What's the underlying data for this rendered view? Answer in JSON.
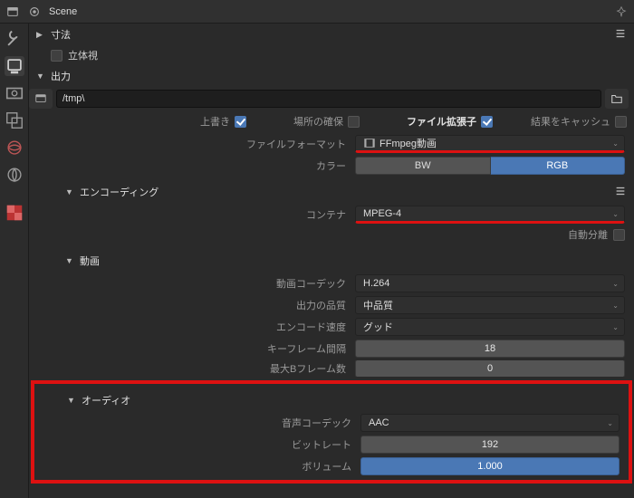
{
  "header": {
    "scene_label": "Scene"
  },
  "sections": {
    "dimensions": "寸法",
    "stereoscopy": "立体視",
    "output": "出力",
    "encoding": "エンコーディング",
    "video": "動画",
    "audio": "オーディオ"
  },
  "output": {
    "path": "/tmp\\",
    "overwrite_label": "上書き",
    "placeholders_label": "場所の確保",
    "file_ext_label": "ファイル拡張子",
    "cache_result_label": "結果をキャッシュ",
    "file_format_label": "ファイルフォーマット",
    "file_format_value": "FFmpeg動画",
    "color_label": "カラー",
    "color_options": {
      "bw": "BW",
      "rgb": "RGB"
    }
  },
  "encoding": {
    "container_label": "コンテナ",
    "container_value": "MPEG-4",
    "autosplit_label": "自動分離"
  },
  "video": {
    "codec_label": "動画コーデック",
    "codec_value": "H.264",
    "quality_label": "出力の品質",
    "quality_value": "中品質",
    "speed_label": "エンコード速度",
    "speed_value": "グッド",
    "keyframe_label": "キーフレーム間隔",
    "keyframe_value": "18",
    "maxb_label": "最大Bフレーム数",
    "maxb_value": "0"
  },
  "audio": {
    "codec_label": "音声コーデック",
    "codec_value": "AAC",
    "bitrate_label": "ビットレート",
    "bitrate_value": "192",
    "volume_label": "ボリューム",
    "volume_value": "1.000"
  }
}
